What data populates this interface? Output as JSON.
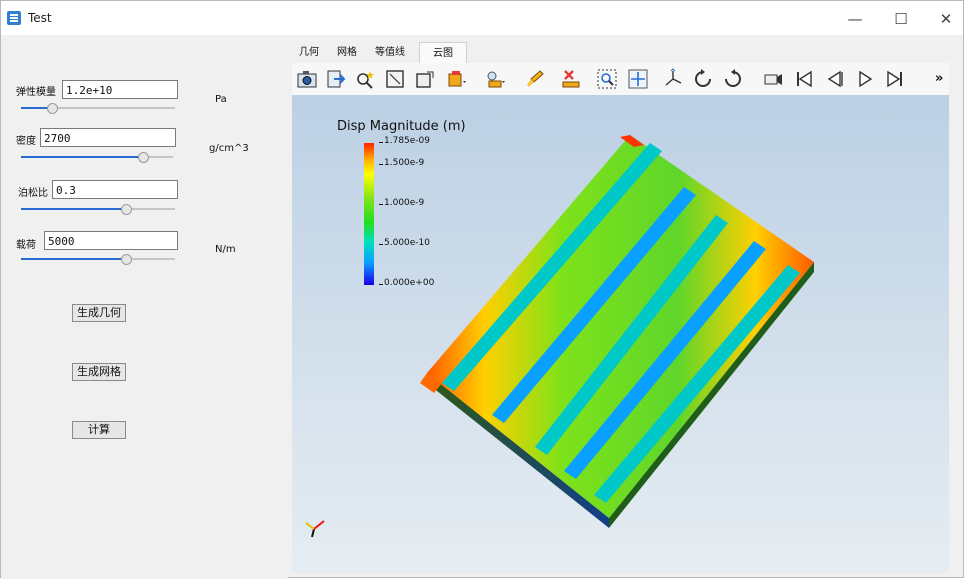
{
  "window": {
    "title": "Test",
    "minimize": "—",
    "maximize": "☐",
    "close": "✕"
  },
  "properties": {
    "elastic": {
      "label": "弹性模量",
      "value": "1.2e+10",
      "unit": "Pa",
      "slider": 0.2
    },
    "density": {
      "label": "密度",
      "value": "2700",
      "unit": "g/cm^3",
      "slider": 0.8
    },
    "poisson": {
      "label": "泊松比",
      "value": "0.3",
      "unit": "",
      "slider": 0.68
    },
    "load": {
      "label": "载荷",
      "value": "5000",
      "unit": "N/m",
      "slider": 0.68
    }
  },
  "buttons": {
    "gen_geometry": "生成几何",
    "gen_mesh": "生成网格",
    "compute": "计算"
  },
  "tabs": [
    "几何",
    "网格",
    "等值线",
    "云图"
  ],
  "active_tab": 3,
  "toolbar": {
    "icons": [
      "camera-icon",
      "export-icon",
      "probe-icon",
      "frame-icon",
      "box-icon",
      "color-map-icon",
      "light-icon",
      "brush-icon",
      "delete-icon",
      "zoom-box-icon",
      "pan-icon",
      "axes-icon",
      "rotate-cw-icon",
      "rotate-ccw-icon",
      "record-icon",
      "first-frame-icon",
      "previous-frame-icon",
      "play-icon",
      "last-frame-icon",
      "more-icon"
    ],
    "more": "»"
  },
  "legend": {
    "title": "Disp Magnitude (m)",
    "ticks": [
      "1.785e-09",
      "1.500e-9",
      "1.000e-9",
      "5.000e-10",
      "0.000e+00"
    ],
    "tick_values": [
      1.785e-09,
      1.5e-09,
      1e-09,
      5e-10,
      0.0
    ],
    "colors": [
      "#ff2200",
      "#ffff00",
      "#22dd22",
      "#00e0c0",
      "#1c00e6"
    ]
  }
}
